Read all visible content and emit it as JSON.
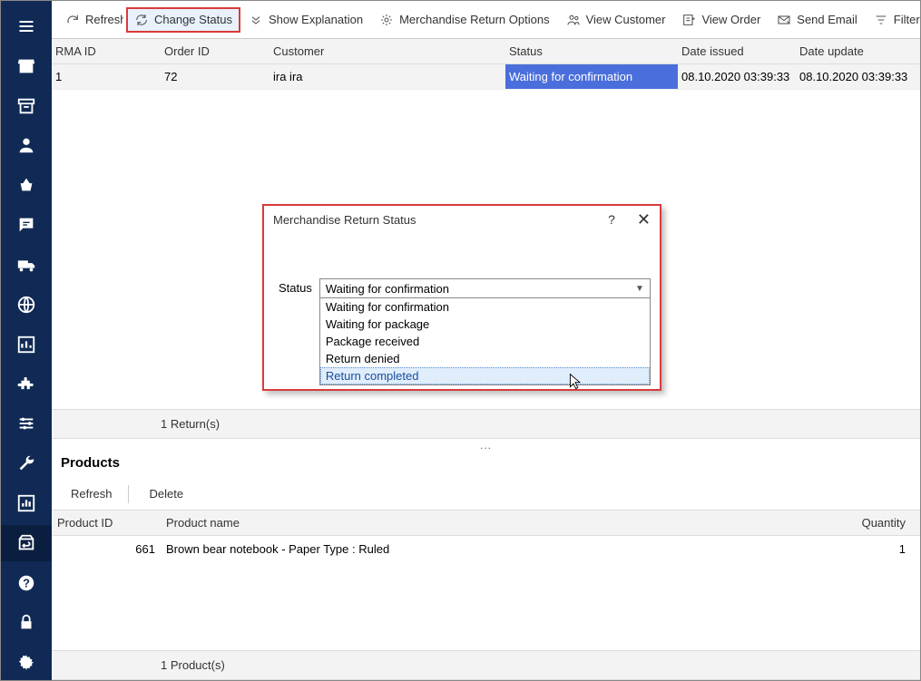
{
  "sidebar": {
    "items": [
      {
        "name": "hamburger-menu",
        "icon": "menu"
      },
      {
        "name": "home",
        "icon": "store"
      },
      {
        "name": "archive",
        "icon": "archive"
      },
      {
        "name": "user",
        "icon": "user"
      },
      {
        "name": "cart",
        "icon": "basket"
      },
      {
        "name": "messages",
        "icon": "chat"
      },
      {
        "name": "shipping",
        "icon": "truck"
      },
      {
        "name": "globe",
        "icon": "globe"
      },
      {
        "name": "stats",
        "icon": "barchart"
      },
      {
        "name": "plugins",
        "icon": "puzzle"
      },
      {
        "name": "filters",
        "icon": "sliders"
      },
      {
        "name": "tools",
        "icon": "wrench"
      },
      {
        "name": "reports",
        "icon": "chart2"
      },
      {
        "name": "returns",
        "icon": "returns",
        "active": true
      },
      {
        "name": "help",
        "icon": "help"
      },
      {
        "name": "lock",
        "icon": "lock"
      },
      {
        "name": "settings",
        "icon": "gear"
      }
    ]
  },
  "toolbar": {
    "refresh": "Refresh",
    "change_status": "Change Status",
    "show_explanation": "Show Explanation",
    "return_options": "Merchandise Return Options",
    "view_customer": "View Customer",
    "view_order": "View Order",
    "send_email": "Send Email",
    "filter_row": "Filter Row"
  },
  "returns_grid": {
    "columns": {
      "rma_id": "RMA ID",
      "order_id": "Order ID",
      "customer": "Customer",
      "status": "Status",
      "date_issued": "Date issued",
      "date_update": "Date update"
    },
    "rows": [
      {
        "rma_id": "1",
        "order_id": "72",
        "customer": "ira ira",
        "status": "Waiting for confirmation",
        "date_issued": "08.10.2020 03:39:33",
        "date_update": "08.10.2020 03:39:33"
      }
    ],
    "footer": "1 Return(s)"
  },
  "splitter_dots": "...",
  "products": {
    "title": "Products",
    "toolbar": {
      "refresh": "Refresh",
      "delete": "Delete"
    },
    "columns": {
      "product_id": "Product ID",
      "product_name": "Product name",
      "quantity": "Quantity"
    },
    "rows": [
      {
        "product_id": "661",
        "product_name": "Brown bear notebook - Paper Type : Ruled",
        "quantity": "1"
      }
    ],
    "footer": "1 Product(s)"
  },
  "dialog": {
    "title": "Merchandise Return Status",
    "help": "?",
    "close": "✕",
    "status_label": "Status",
    "selected": "Waiting for confirmation",
    "options": [
      "Waiting for confirmation",
      "Waiting for package",
      "Package received",
      "Return denied",
      "Return completed"
    ],
    "hovered_index": 4
  }
}
